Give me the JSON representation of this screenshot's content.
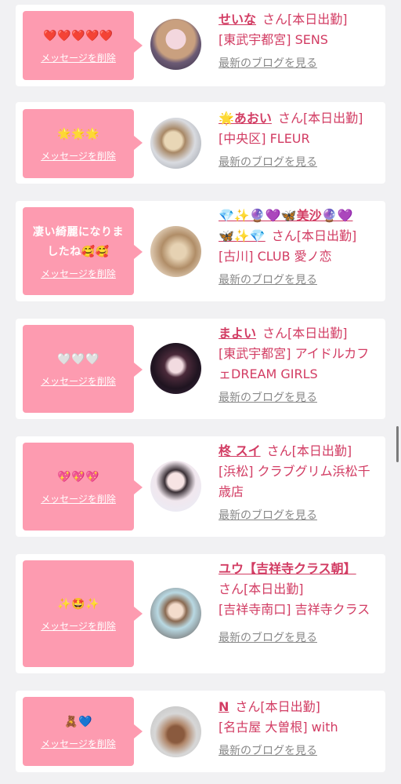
{
  "common": {
    "delete_label": "メッセージを削除",
    "blog_label": "最新のブログを見る",
    "san_status": "さん[本日出勤]"
  },
  "colors": {
    "accent": "#d23c63",
    "message_bg": "#fd9bb0",
    "page_bg": "#f1f1f3",
    "card_bg": "#ffffff"
  },
  "cards": [
    {
      "message": "❤️❤️❤️❤️❤️",
      "name": "せいな",
      "name_tail": "",
      "location": "[東武宇都宮] SENS"
    },
    {
      "message": "🌟🌟🌟",
      "name": "🌟あおい",
      "name_tail": "",
      "location": "[中央区] FLEUR"
    },
    {
      "message": "凄い綺麗になりましたね🥰🥰",
      "name": "💎✨🔮💜🦋美沙🔮💜",
      "name_tail": "🦋✨💎",
      "location": "[古川] CLUB 愛ノ恋"
    },
    {
      "message": "🤍🤍🤍",
      "name": "まよい",
      "name_tail": "",
      "location": "[東武宇都宮] アイドルカフェDREAM GIRLS"
    },
    {
      "message": "💖💖💖",
      "name": "柊 スイ",
      "name_tail": "",
      "location": "[浜松] クラブグリム浜松千歳店"
    },
    {
      "message": "✨🤩✨",
      "name": "ユウ【吉祥寺クラス朝】",
      "name_tail": "",
      "location": "[吉祥寺南口] 吉祥寺クラス"
    },
    {
      "message": "🧸💙",
      "name": "N",
      "name_tail": "",
      "location": "[名古屋 大曽根] with"
    }
  ]
}
